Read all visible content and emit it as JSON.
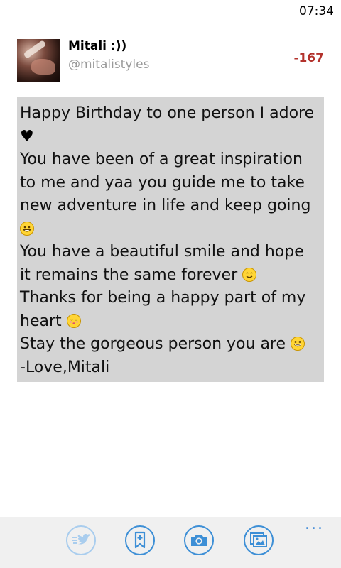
{
  "status_bar": {
    "time": "07:34"
  },
  "account": {
    "display_name": "Mitali :))",
    "handle": "@mitalistyles",
    "avatar_icon": "profile-photo"
  },
  "char_count": "-167",
  "compose": {
    "lines": [
      "Happy Birthday to one person I adore",
      "You have been of a great inspiration",
      "to me and yaa you guide me to take",
      "new adventure in life and keep going",
      "You have a beautiful smile and hope",
      "it remains the same forever",
      "Thanks for being a happy part of my",
      "heart",
      "Stay the gorgeous person you are",
      "-Love,Mitali"
    ],
    "background": "#d4d4d4"
  },
  "app_bar": {
    "buttons": [
      {
        "name": "tweet",
        "icon": "tweet-icon",
        "enabled": false
      },
      {
        "name": "drafts",
        "icon": "bookmark-add-icon",
        "enabled": true
      },
      {
        "name": "camera",
        "icon": "camera-icon",
        "enabled": true
      },
      {
        "name": "gallery",
        "icon": "picture-icon",
        "enabled": true
      }
    ],
    "more": "..."
  },
  "colors": {
    "accent": "#3d8fd6",
    "negative_count": "#b3322c",
    "handle": "#9a9a9a"
  }
}
